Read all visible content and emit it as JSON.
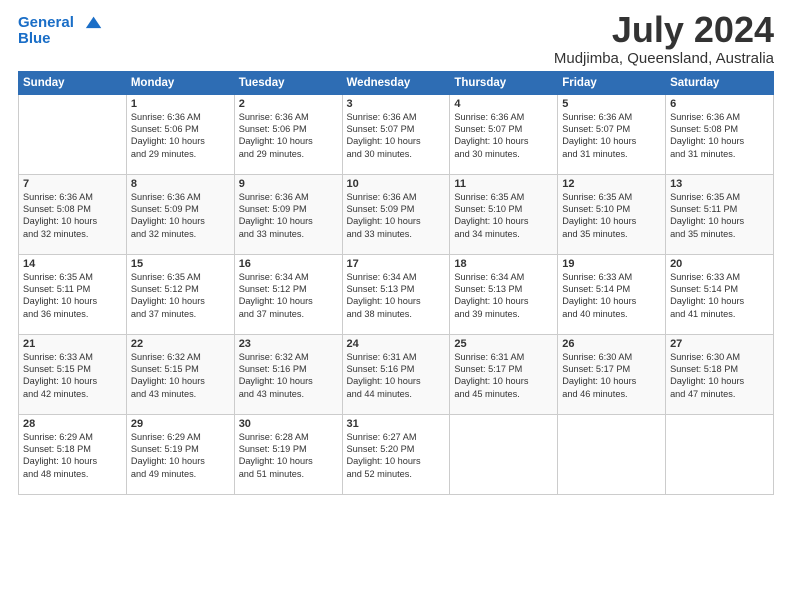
{
  "header": {
    "logo_line1": "General",
    "logo_line2": "Blue",
    "month": "July 2024",
    "location": "Mudjimba, Queensland, Australia"
  },
  "days_of_week": [
    "Sunday",
    "Monday",
    "Tuesday",
    "Wednesday",
    "Thursday",
    "Friday",
    "Saturday"
  ],
  "weeks": [
    [
      {
        "day": "",
        "text": ""
      },
      {
        "day": "1",
        "text": "Sunrise: 6:36 AM\nSunset: 5:06 PM\nDaylight: 10 hours\nand 29 minutes."
      },
      {
        "day": "2",
        "text": "Sunrise: 6:36 AM\nSunset: 5:06 PM\nDaylight: 10 hours\nand 29 minutes."
      },
      {
        "day": "3",
        "text": "Sunrise: 6:36 AM\nSunset: 5:07 PM\nDaylight: 10 hours\nand 30 minutes."
      },
      {
        "day": "4",
        "text": "Sunrise: 6:36 AM\nSunset: 5:07 PM\nDaylight: 10 hours\nand 30 minutes."
      },
      {
        "day": "5",
        "text": "Sunrise: 6:36 AM\nSunset: 5:07 PM\nDaylight: 10 hours\nand 31 minutes."
      },
      {
        "day": "6",
        "text": "Sunrise: 6:36 AM\nSunset: 5:08 PM\nDaylight: 10 hours\nand 31 minutes."
      }
    ],
    [
      {
        "day": "7",
        "text": "Sunrise: 6:36 AM\nSunset: 5:08 PM\nDaylight: 10 hours\nand 32 minutes."
      },
      {
        "day": "8",
        "text": "Sunrise: 6:36 AM\nSunset: 5:09 PM\nDaylight: 10 hours\nand 32 minutes."
      },
      {
        "day": "9",
        "text": "Sunrise: 6:36 AM\nSunset: 5:09 PM\nDaylight: 10 hours\nand 33 minutes."
      },
      {
        "day": "10",
        "text": "Sunrise: 6:36 AM\nSunset: 5:09 PM\nDaylight: 10 hours\nand 33 minutes."
      },
      {
        "day": "11",
        "text": "Sunrise: 6:35 AM\nSunset: 5:10 PM\nDaylight: 10 hours\nand 34 minutes."
      },
      {
        "day": "12",
        "text": "Sunrise: 6:35 AM\nSunset: 5:10 PM\nDaylight: 10 hours\nand 35 minutes."
      },
      {
        "day": "13",
        "text": "Sunrise: 6:35 AM\nSunset: 5:11 PM\nDaylight: 10 hours\nand 35 minutes."
      }
    ],
    [
      {
        "day": "14",
        "text": "Sunrise: 6:35 AM\nSunset: 5:11 PM\nDaylight: 10 hours\nand 36 minutes."
      },
      {
        "day": "15",
        "text": "Sunrise: 6:35 AM\nSunset: 5:12 PM\nDaylight: 10 hours\nand 37 minutes."
      },
      {
        "day": "16",
        "text": "Sunrise: 6:34 AM\nSunset: 5:12 PM\nDaylight: 10 hours\nand 37 minutes."
      },
      {
        "day": "17",
        "text": "Sunrise: 6:34 AM\nSunset: 5:13 PM\nDaylight: 10 hours\nand 38 minutes."
      },
      {
        "day": "18",
        "text": "Sunrise: 6:34 AM\nSunset: 5:13 PM\nDaylight: 10 hours\nand 39 minutes."
      },
      {
        "day": "19",
        "text": "Sunrise: 6:33 AM\nSunset: 5:14 PM\nDaylight: 10 hours\nand 40 minutes."
      },
      {
        "day": "20",
        "text": "Sunrise: 6:33 AM\nSunset: 5:14 PM\nDaylight: 10 hours\nand 41 minutes."
      }
    ],
    [
      {
        "day": "21",
        "text": "Sunrise: 6:33 AM\nSunset: 5:15 PM\nDaylight: 10 hours\nand 42 minutes."
      },
      {
        "day": "22",
        "text": "Sunrise: 6:32 AM\nSunset: 5:15 PM\nDaylight: 10 hours\nand 43 minutes."
      },
      {
        "day": "23",
        "text": "Sunrise: 6:32 AM\nSunset: 5:16 PM\nDaylight: 10 hours\nand 43 minutes."
      },
      {
        "day": "24",
        "text": "Sunrise: 6:31 AM\nSunset: 5:16 PM\nDaylight: 10 hours\nand 44 minutes."
      },
      {
        "day": "25",
        "text": "Sunrise: 6:31 AM\nSunset: 5:17 PM\nDaylight: 10 hours\nand 45 minutes."
      },
      {
        "day": "26",
        "text": "Sunrise: 6:30 AM\nSunset: 5:17 PM\nDaylight: 10 hours\nand 46 minutes."
      },
      {
        "day": "27",
        "text": "Sunrise: 6:30 AM\nSunset: 5:18 PM\nDaylight: 10 hours\nand 47 minutes."
      }
    ],
    [
      {
        "day": "28",
        "text": "Sunrise: 6:29 AM\nSunset: 5:18 PM\nDaylight: 10 hours\nand 48 minutes."
      },
      {
        "day": "29",
        "text": "Sunrise: 6:29 AM\nSunset: 5:19 PM\nDaylight: 10 hours\nand 49 minutes."
      },
      {
        "day": "30",
        "text": "Sunrise: 6:28 AM\nSunset: 5:19 PM\nDaylight: 10 hours\nand 51 minutes."
      },
      {
        "day": "31",
        "text": "Sunrise: 6:27 AM\nSunset: 5:20 PM\nDaylight: 10 hours\nand 52 minutes."
      },
      {
        "day": "",
        "text": ""
      },
      {
        "day": "",
        "text": ""
      },
      {
        "day": "",
        "text": ""
      }
    ]
  ]
}
